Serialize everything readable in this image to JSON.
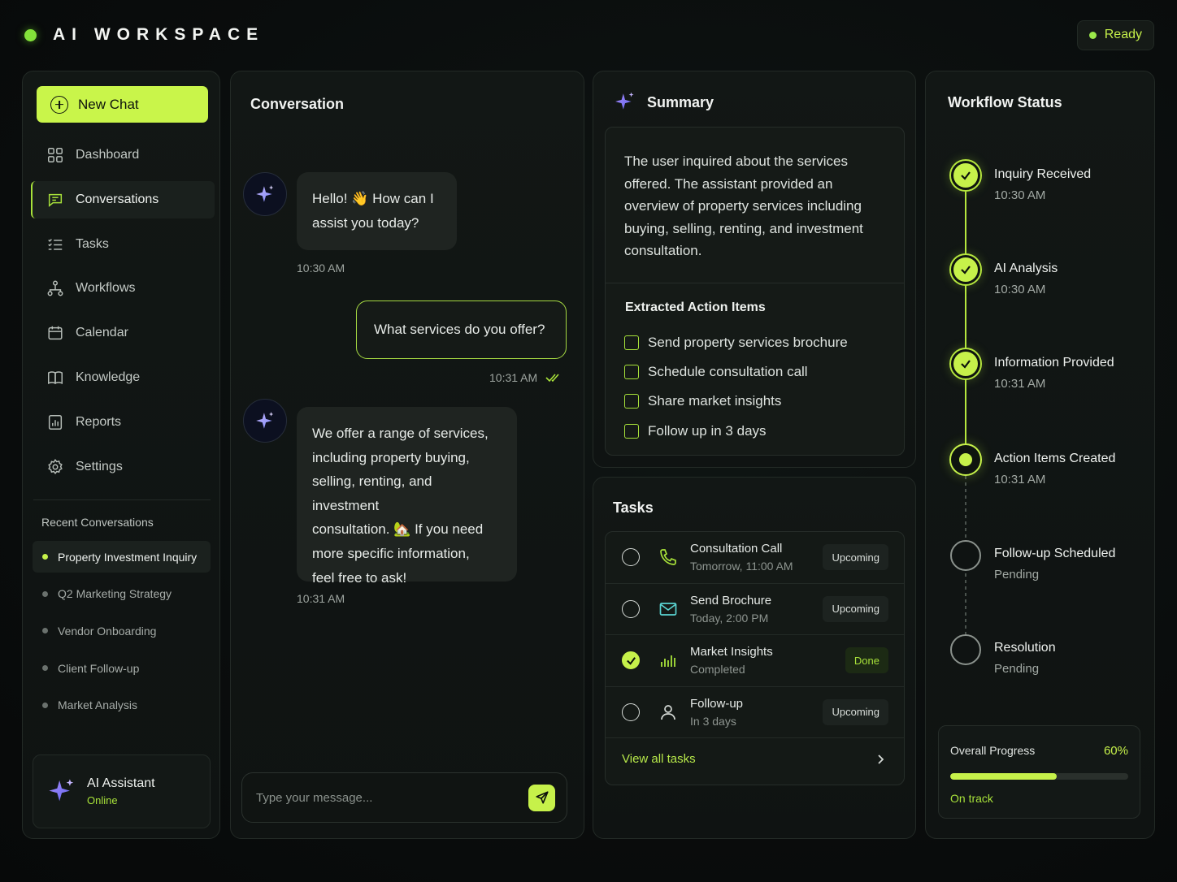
{
  "header": {
    "title": "AI WORKSPACE",
    "status": "Ready"
  },
  "sidebar": {
    "new_chat": "New Chat",
    "nav": [
      {
        "label": "Dashboard",
        "icon": "grid-icon"
      },
      {
        "label": "Conversations",
        "icon": "chat-icon",
        "active": true
      },
      {
        "label": "Tasks",
        "icon": "checklist-icon"
      },
      {
        "label": "Workflows",
        "icon": "workflow-icon"
      },
      {
        "label": "Calendar",
        "icon": "calendar-icon"
      },
      {
        "label": "Knowledge",
        "icon": "book-icon"
      },
      {
        "label": "Reports",
        "icon": "report-icon"
      },
      {
        "label": "Settings",
        "icon": "gear-icon"
      }
    ],
    "recent_title": "Recent Conversations",
    "recent": [
      "Property Investment Inquiry",
      "Q2 Marketing Strategy",
      "Vendor Onboarding",
      "Client Follow-up",
      "Market Analysis"
    ],
    "assistant": {
      "name": "AI Assistant",
      "status": "Online"
    }
  },
  "conversation": {
    "title": "Conversation",
    "messages": [
      {
        "role": "assistant",
        "lines": [
          "Hello! 👋 How can I",
          "assist you today?"
        ],
        "time": "10:30 AM"
      },
      {
        "role": "user",
        "text": "What services do you offer?",
        "time": "10:31 AM"
      },
      {
        "role": "assistant",
        "lines": [
          "We offer a range of services,",
          "including property buying,",
          "selling, renting, and investment",
          "consultation. 🏡 If you need",
          "more specific information,",
          "feel free to ask!"
        ],
        "time": "10:31 AM"
      }
    ],
    "input_placeholder": "Type your message..."
  },
  "summary": {
    "title": "Summary",
    "text": "The user inquired about the services offered. The assistant provided an overview of property services including buying, selling, renting, and investment consultation.",
    "action_title": "Extracted Action Items",
    "actions": [
      "Send property services brochure",
      "Schedule consultation call",
      "Share market insights",
      "Follow up in 3 days"
    ]
  },
  "tasks": {
    "title": "Tasks",
    "items": [
      {
        "name": "Consultation Call",
        "sub": "Tomorrow, 11:00 AM",
        "status": "Upcoming",
        "done": false,
        "icon": "phone-icon"
      },
      {
        "name": "Send Brochure",
        "sub": "Today, 2:00 PM",
        "status": "Upcoming",
        "done": false,
        "icon": "mail-icon"
      },
      {
        "name": "Market Insights",
        "sub": "Completed",
        "status": "Done",
        "done": true,
        "icon": "bar-chart-icon"
      },
      {
        "name": "Follow-up",
        "sub": "In 3 days",
        "status": "Upcoming",
        "done": false,
        "icon": "user-icon"
      }
    ],
    "view_all": "View all tasks"
  },
  "workflow": {
    "title": "Workflow Status",
    "steps": [
      {
        "name": "Inquiry Received",
        "time": "10:30 AM",
        "state": "done"
      },
      {
        "name": "AI Analysis",
        "time": "10:30 AM",
        "state": "done"
      },
      {
        "name": "Information Provided",
        "time": "10:31 AM",
        "state": "done"
      },
      {
        "name": "Action Items Created",
        "time": "10:31 AM",
        "state": "current"
      },
      {
        "name": "Follow-up Scheduled",
        "time": "Pending",
        "state": "pending"
      },
      {
        "name": "Resolution",
        "time": "Pending",
        "state": "pending"
      }
    ],
    "progress": {
      "label": "Overall Progress",
      "percent_label": "60%",
      "value": 0.6,
      "note": "On track"
    }
  },
  "colors": {
    "accent": "#c6f14a",
    "accent_dim": "#a8e23a",
    "background": "#090c0c",
    "panel": "#121715"
  }
}
